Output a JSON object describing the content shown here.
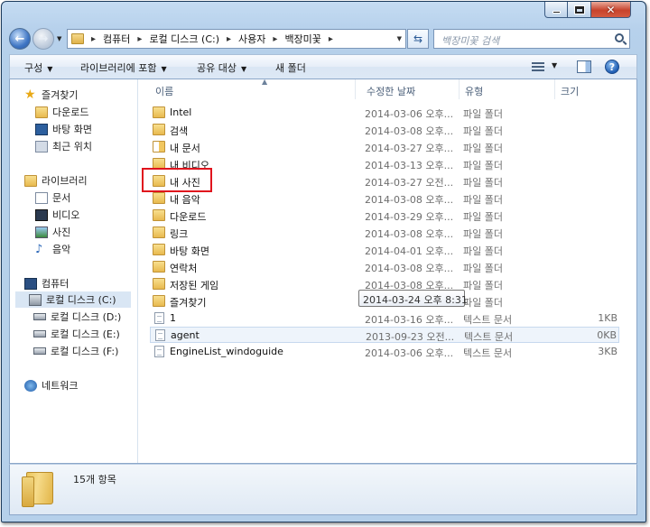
{
  "address": {
    "crumbs": [
      "컴퓨터",
      "로컬 디스크 (C:)",
      "사용자",
      "백장미꽃"
    ]
  },
  "search": {
    "placeholder": "백장미꽃 검색"
  },
  "toolbar": {
    "organize": "구성",
    "include_library": "라이브러리에 포함",
    "share": "공유 대상",
    "new_folder": "새 폴더"
  },
  "nav": {
    "favorites": "즐겨찾기",
    "downloads": "다운로드",
    "desktop": "바탕 화면",
    "recent": "최근 위치",
    "libraries": "라이브러리",
    "documents": "문서",
    "videos": "비디오",
    "pictures": "사진",
    "music": "음악",
    "computer": "컴퓨터",
    "drive_c": "로컬 디스크 (C:)",
    "drive_d": "로컬 디스크 (D:)",
    "drive_e": "로컬 디스크 (E:)",
    "drive_f": "로컬 디스크 (F:)",
    "network": "네트워크"
  },
  "columns": {
    "name": "이름",
    "date": "수정한 날짜",
    "type": "유형",
    "size": "크기"
  },
  "files": [
    {
      "name": "Intel",
      "date": "2014-03-06 오후...",
      "type": "파일 폴더",
      "size": "",
      "icon": "folder-icon"
    },
    {
      "name": "검색",
      "date": "2014-03-08 오후...",
      "type": "파일 폴더",
      "size": "",
      "icon": "search-folder-icon"
    },
    {
      "name": "내 문서",
      "date": "2014-03-27 오후...",
      "type": "파일 폴더",
      "size": "",
      "icon": "documents-folder-icon"
    },
    {
      "name": "내 비디오",
      "date": "2014-03-13 오후...",
      "type": "파일 폴더",
      "size": "",
      "icon": "videos-folder-icon"
    },
    {
      "name": "내 사진",
      "date": "2014-03-27 오전...",
      "type": "파일 폴더",
      "size": "",
      "icon": "pictures-folder-icon"
    },
    {
      "name": "내 음악",
      "date": "2014-03-08 오후...",
      "type": "파일 폴더",
      "size": "",
      "icon": "music-folder-icon"
    },
    {
      "name": "다운로드",
      "date": "2014-03-29 오후...",
      "type": "파일 폴더",
      "size": "",
      "icon": "downloads-folder-icon"
    },
    {
      "name": "링크",
      "date": "2014-03-08 오후...",
      "type": "파일 폴더",
      "size": "",
      "icon": "links-folder-icon"
    },
    {
      "name": "바탕 화면",
      "date": "2014-04-01 오후...",
      "type": "파일 폴더",
      "size": "",
      "icon": "desktop-folder-icon"
    },
    {
      "name": "연락처",
      "date": "2014-03-08 오후...",
      "type": "파일 폴더",
      "size": "",
      "icon": "contacts-folder-icon"
    },
    {
      "name": "저장된 게임",
      "date": "2014-03-08 오후...",
      "type": "파일 폴더",
      "size": "",
      "icon": "saved-games-folder-icon"
    },
    {
      "name": "즐겨찾기",
      "date": "",
      "type": "파일 폴더",
      "size": "",
      "icon": "favorites-folder-icon"
    },
    {
      "name": "1",
      "date": "2014-03-16 오후...",
      "type": "텍스트 문서",
      "size": "1KB",
      "icon": "text-file-icon"
    },
    {
      "name": "agent",
      "date": "2013-09-23 오전...",
      "type": "텍스트 문서",
      "size": "0KB",
      "icon": "text-file-icon"
    },
    {
      "name": "EngineList_windoguide",
      "date": "2014-03-06 오후...",
      "type": "텍스트 문서",
      "size": "3KB",
      "icon": "text-file-icon"
    }
  ],
  "tooltip": "2014-03-24 오후 8:31",
  "status": {
    "count": "15개 항목"
  },
  "colors": {
    "highlight": "#e0141d",
    "frame": "#b7d1ec",
    "selection": "#d9e6f4"
  }
}
